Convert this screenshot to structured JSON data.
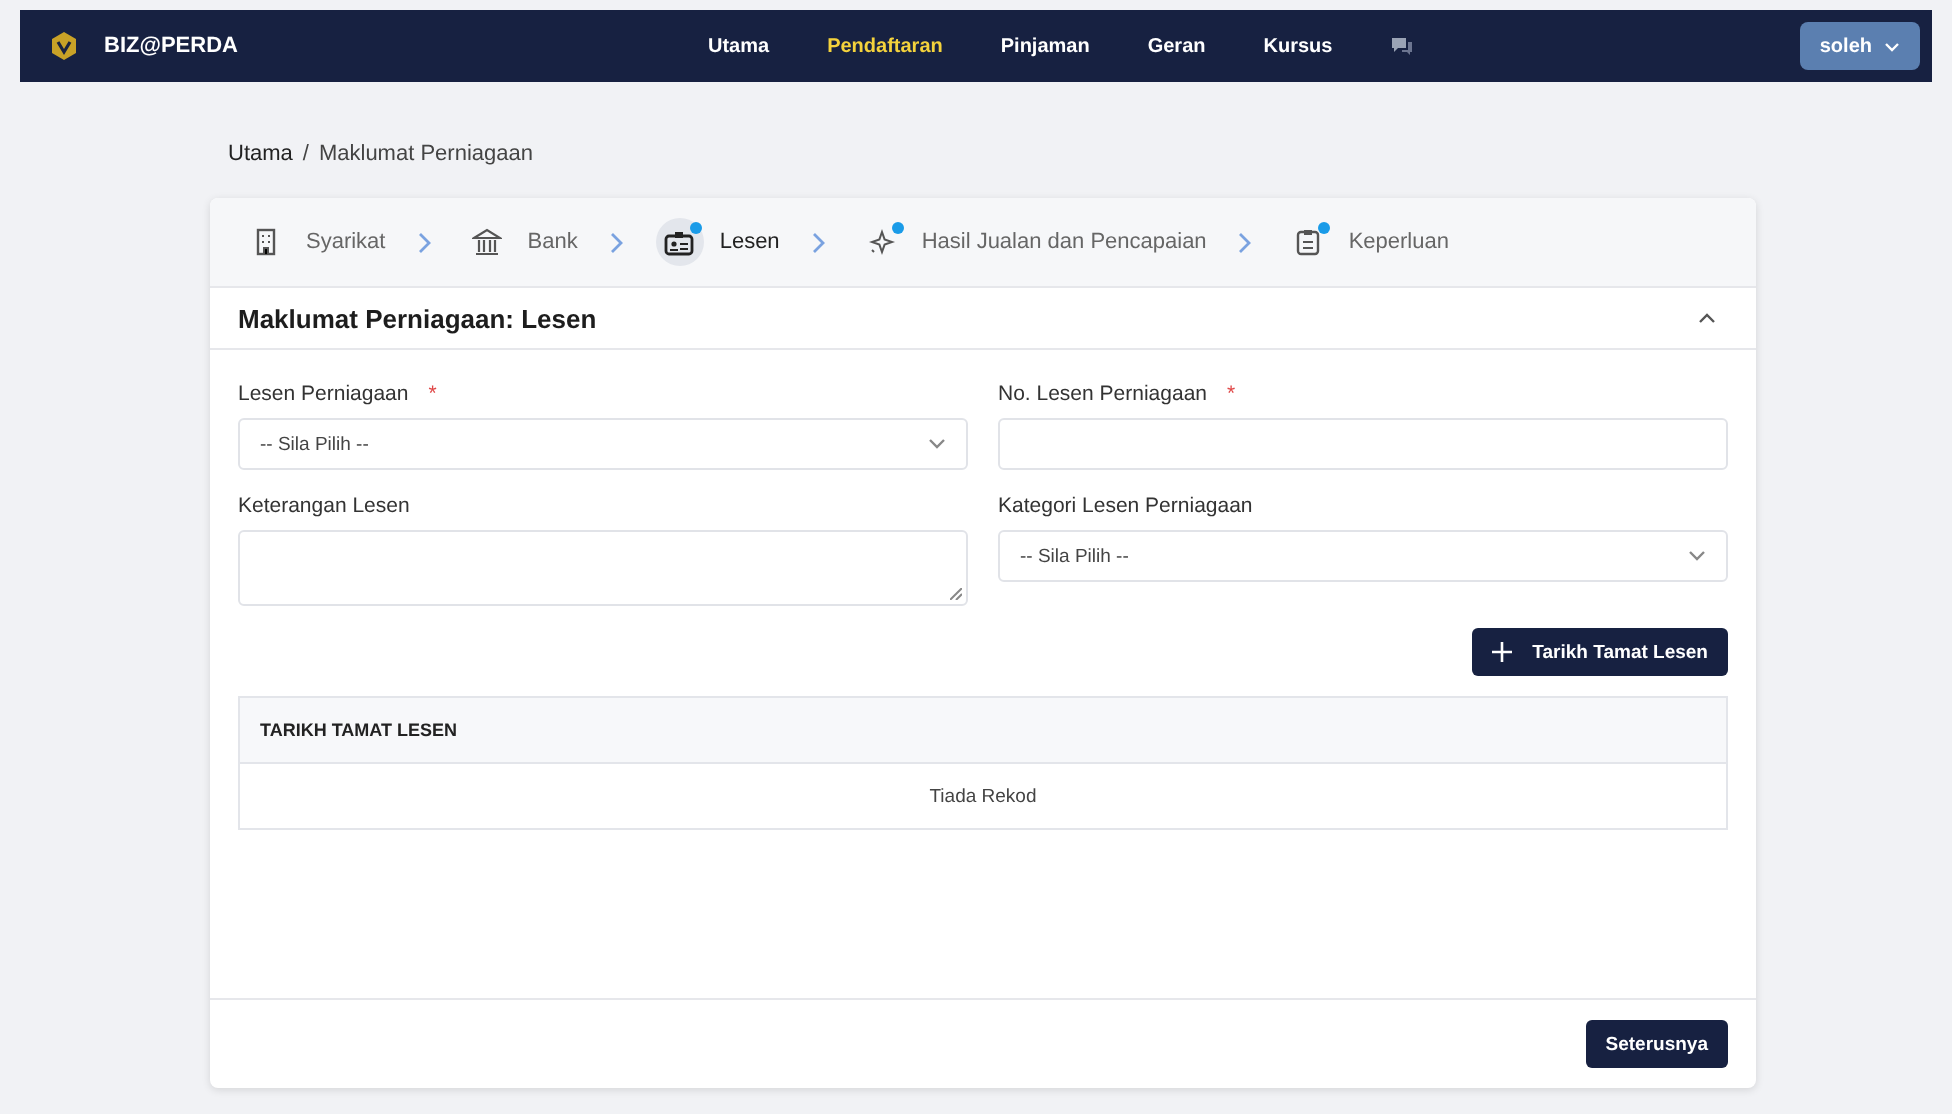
{
  "navbar": {
    "brand": "BIZ@PERDA",
    "menu": [
      {
        "label": "Utama",
        "selected": false
      },
      {
        "label": "Pendaftaran",
        "selected": true
      },
      {
        "label": "Pinjaman",
        "selected": false
      },
      {
        "label": "Geran",
        "selected": false
      },
      {
        "label": "Kursus",
        "selected": false
      }
    ],
    "user": "soleh"
  },
  "breadcrumb": [
    "Utama",
    "Maklumat Perniagaan"
  ],
  "breadcrumb_separator": "/",
  "required_mark": "*",
  "steps": [
    {
      "label": "Syarikat",
      "selected": false,
      "notice": false
    },
    {
      "label": "Bank",
      "selected": false,
      "notice": false
    },
    {
      "label": "Lesen",
      "selected": true,
      "notice": true
    },
    {
      "label": "Hasil Jualan dan Pencapaian",
      "selected": false,
      "notice": true
    },
    {
      "label": "Keperluan",
      "selected": false,
      "notice": true
    }
  ],
  "section_title": "Maklumat Perniagaan: Lesen",
  "fields": [
    {
      "label": "Lesen Perniagaan",
      "required": true,
      "kind": "select",
      "value": "-- Sila Pilih --"
    },
    {
      "label": "No. Lesen Perniagaan",
      "required": true,
      "kind": "input"
    },
    {
      "label": "Keterangan Lesen",
      "required": false,
      "kind": "textarea"
    },
    {
      "label": "Kategori Lesen Perniagaan",
      "required": false,
      "kind": "select",
      "value": "-- Sila Pilih --"
    }
  ],
  "add_button": "Tarikh Tamat Lesen",
  "table": {
    "columns": [
      "TARIKH TAMAT LESEN"
    ],
    "empty": "Tiada Rekod"
  },
  "next_button": "Seterusnya"
}
